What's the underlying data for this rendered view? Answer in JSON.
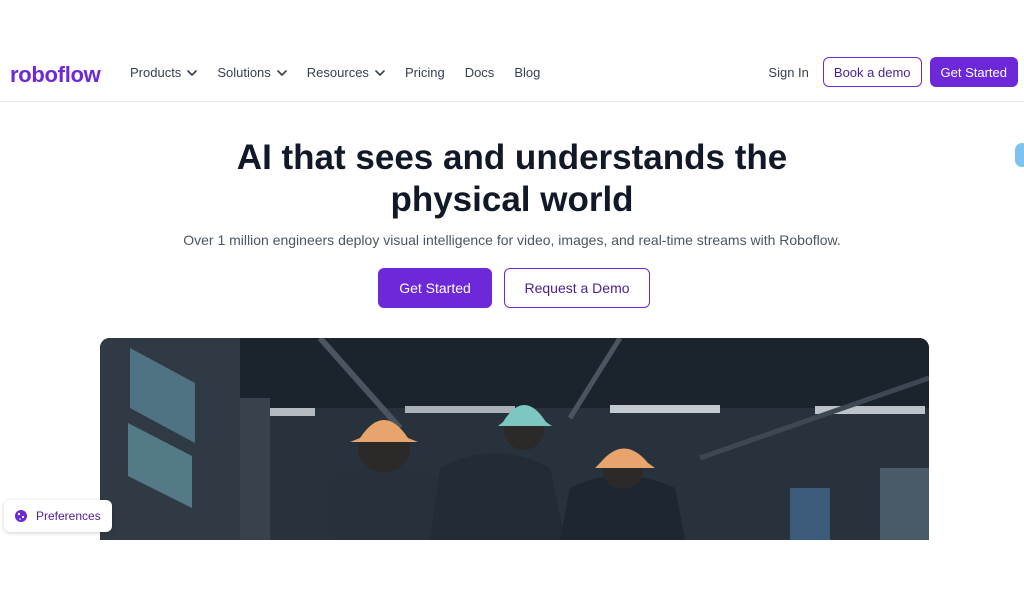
{
  "header": {
    "logo": "roboflow",
    "nav": [
      {
        "label": "Products",
        "dropdown": true
      },
      {
        "label": "Solutions",
        "dropdown": true
      },
      {
        "label": "Resources",
        "dropdown": true
      },
      {
        "label": "Pricing",
        "dropdown": false
      },
      {
        "label": "Docs",
        "dropdown": false
      },
      {
        "label": "Blog",
        "dropdown": false
      }
    ],
    "sign_in": "Sign In",
    "book_demo": "Book a demo",
    "get_started": "Get Started"
  },
  "hero": {
    "title_line1": "AI that sees and understands the",
    "title_line2": "physical world",
    "subtitle": "Over 1 million engineers deploy visual intelligence for video, images, and real-time streams with Roboflow.",
    "primary_cta": "Get Started",
    "secondary_cta": "Request a Demo"
  },
  "cookie": {
    "preferences_label": "Preferences"
  },
  "colors": {
    "brand": "#6d28d9",
    "brand_dark": "#4c1d95",
    "text": "#111827"
  },
  "icons": {
    "chevron": "chevron-down-icon",
    "preferences": "cookie-icon"
  }
}
